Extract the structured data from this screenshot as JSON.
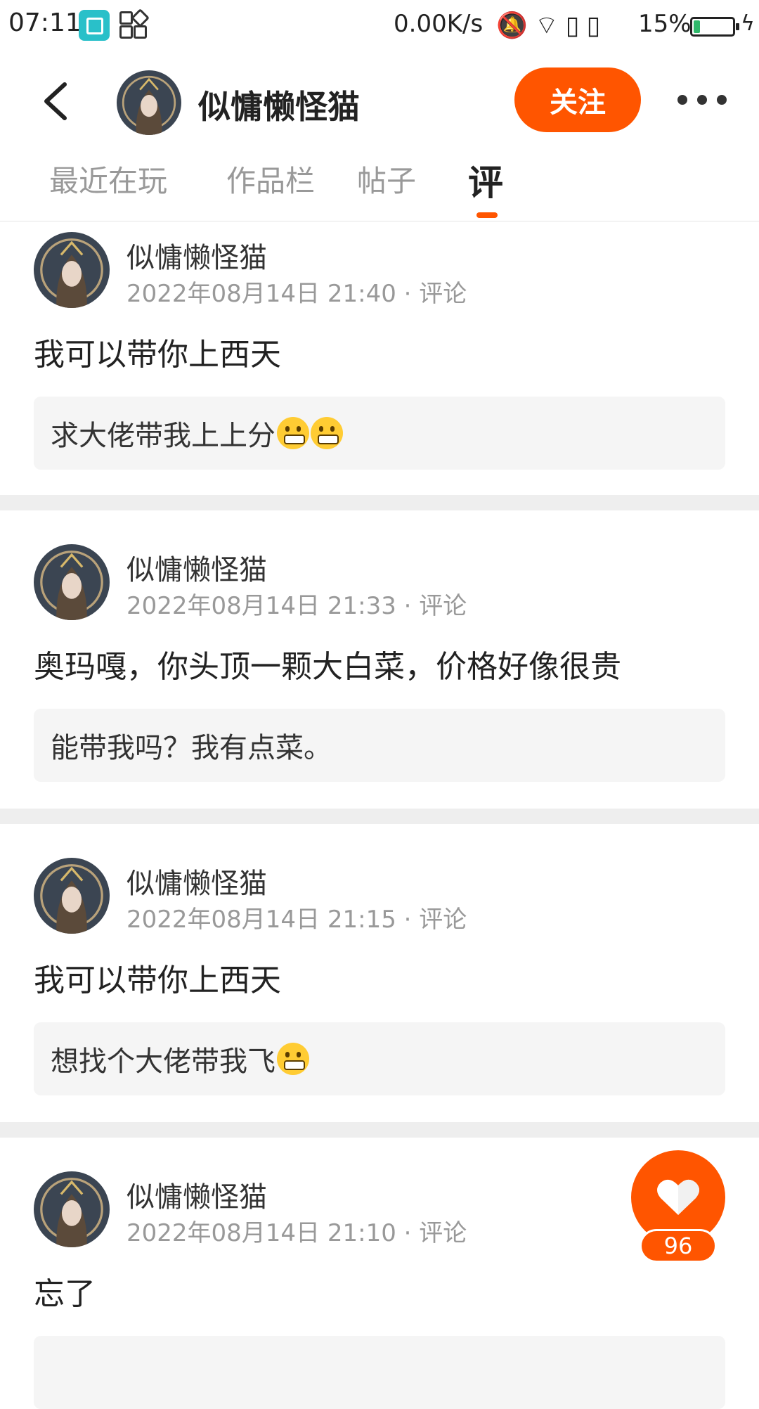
{
  "status_bar": {
    "time": "07:11",
    "net_speed": "0.00K/s",
    "battery_percent": "15%",
    "icons": [
      "screenshot-app-icon",
      "apps-grid-icon",
      "mute-bell-icon",
      "wifi-icon",
      "sim1-icon",
      "sim2-icon",
      "battery-icon",
      "charging-icon"
    ]
  },
  "header": {
    "name": "似慵懒怪猫",
    "follow_label": "关注"
  },
  "tabs": [
    {
      "label": "最近在玩"
    },
    {
      "label": "作品栏"
    },
    {
      "label": "帖子"
    },
    {
      "label": "评"
    }
  ],
  "active_tab": 3,
  "comments": [
    {
      "name": "似慵懒怪猫",
      "date": "2022年08月14日 21:40",
      "type": "评论",
      "body": "我可以带你上西天",
      "quote": "求大佬带我上上分",
      "quote_emojis": 2
    },
    {
      "name": "似慵懒怪猫",
      "date": "2022年08月14日 21:33",
      "type": "评论",
      "body": "奥玛嘎，你头顶一颗大白菜，价格好像很贵",
      "quote": "能带我吗？我有点菜。",
      "quote_emojis": 0
    },
    {
      "name": "似慵懒怪猫",
      "date": "2022年08月14日 21:15",
      "type": "评论",
      "body": "我可以带你上西天",
      "quote": "想找个大佬带我飞",
      "quote_emojis": 1
    },
    {
      "name": "似慵懒怪猫",
      "date": "2022年08月14日 21:10",
      "type": "评论",
      "body": "忘了",
      "quote": "",
      "quote_emojis": 0
    }
  ],
  "like": {
    "count": "96"
  },
  "colors": {
    "accent": "#ff5500",
    "muted": "#999999",
    "quote_bg": "#f5f5f5"
  }
}
